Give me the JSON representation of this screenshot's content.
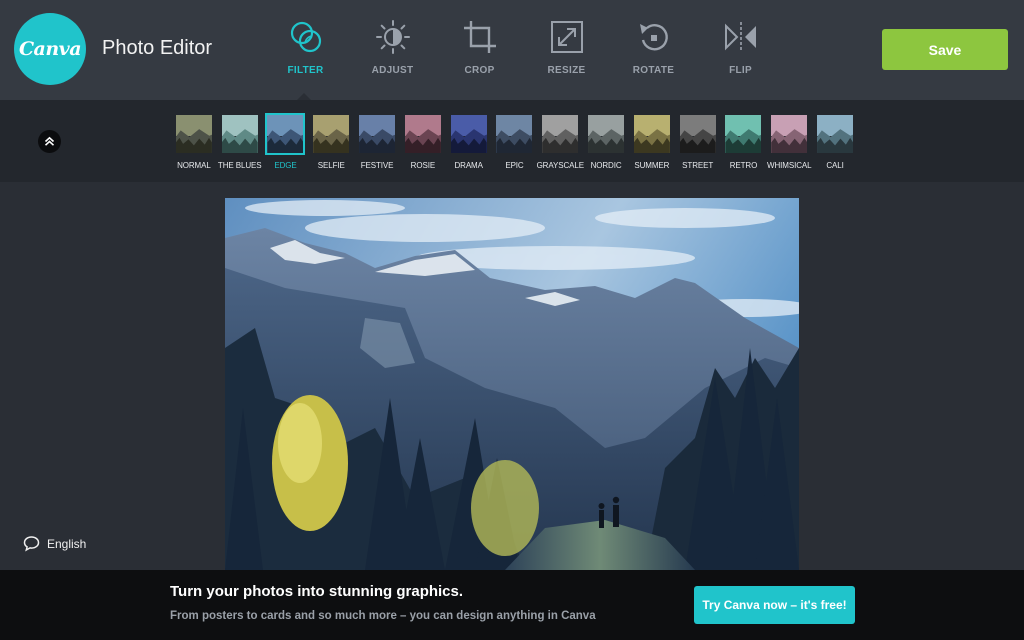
{
  "header": {
    "logo_text": "Canva",
    "title": "Photo Editor",
    "save_label": "Save",
    "accent": "#20c4cb",
    "save_color": "#8dc63f"
  },
  "tools": [
    {
      "label": "FILTER",
      "icon": "filter-icon",
      "active": true
    },
    {
      "label": "ADJUST",
      "icon": "adjust-icon",
      "active": false
    },
    {
      "label": "CROP",
      "icon": "crop-icon",
      "active": false
    },
    {
      "label": "RESIZE",
      "icon": "resize-icon",
      "active": false
    },
    {
      "label": "ROTATE",
      "icon": "rotate-icon",
      "active": false
    },
    {
      "label": "FLIP",
      "icon": "flip-icon",
      "active": false
    }
  ],
  "filter_bar": {
    "collapse_icon": "chevron-double-up-icon",
    "active_filter": "EDGE",
    "filters": [
      {
        "label": "NORMAL",
        "sky": "#8a9070",
        "mtn": "#4d5248",
        "trees": "#2b2d22"
      },
      {
        "label": "THE BLUES",
        "sky": "#9fc2c0",
        "mtn": "#5f8a86",
        "trees": "#2e4a47"
      },
      {
        "label": "EDGE",
        "sky": "#6d93b8",
        "mtn": "#3d5676",
        "trees": "#1c2a3a"
      },
      {
        "label": "SELFIE",
        "sky": "#a8a070",
        "mtn": "#6a6448",
        "trees": "#35321f"
      },
      {
        "label": "FESTIVE",
        "sky": "#6880a8",
        "mtn": "#3a4a66",
        "trees": "#1d2534"
      },
      {
        "label": "ROSIE",
        "sky": "#b07a8c",
        "mtn": "#6a4452",
        "trees": "#341f27"
      },
      {
        "label": "DRAMA",
        "sky": "#4a5ca8",
        "mtn": "#2a3570",
        "trees": "#141a3a"
      },
      {
        "label": "EPIC",
        "sky": "#6e86a4",
        "mtn": "#3d4c62",
        "trees": "#1f2734"
      },
      {
        "label": "GRAYSCALE",
        "sky": "#a0a0a0",
        "mtn": "#606060",
        "trees": "#2e2e2e"
      },
      {
        "label": "NORDIC",
        "sky": "#98a0a0",
        "mtn": "#5c6464",
        "trees": "#2c3232"
      },
      {
        "label": "SUMMER",
        "sky": "#b8b070",
        "mtn": "#7a7244",
        "trees": "#3c3820"
      },
      {
        "label": "STREET",
        "sky": "#7c7c7c",
        "mtn": "#454545",
        "trees": "#1c1c1c"
      },
      {
        "label": "RETRO",
        "sky": "#70c0b0",
        "mtn": "#3f7a70",
        "trees": "#1d3c36"
      },
      {
        "label": "WHIMSICAL",
        "sky": "#c8a0b4",
        "mtn": "#866474",
        "trees": "#42303a"
      },
      {
        "label": "CALI",
        "sky": "#8cb0c4",
        "mtn": "#52727e",
        "trees": "#29383e"
      }
    ]
  },
  "language": {
    "label": "English",
    "icon": "speech-bubble-icon"
  },
  "banner": {
    "title": "Turn your photos into stunning graphics.",
    "subtitle": "From posters to cards and so much more – you can design anything in Canva",
    "cta_label": "Try Canva now – it's free!"
  }
}
